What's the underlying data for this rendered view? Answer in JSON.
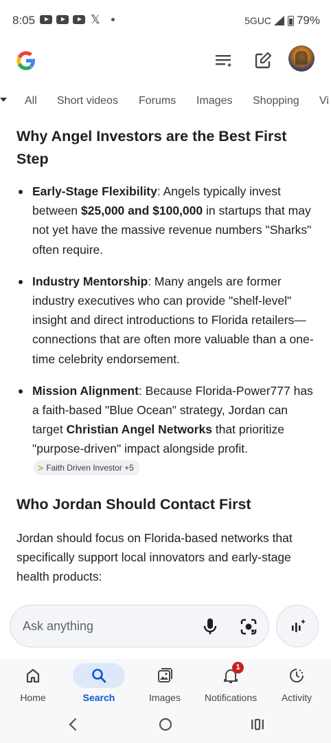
{
  "status_bar": {
    "time": "8:05",
    "network": "5GUC",
    "battery": "79%",
    "icons": [
      "youtube-icon",
      "youtube-icon",
      "youtube-icon",
      "x-icon",
      "dot-icon",
      "signal-icon",
      "battery-icon"
    ]
  },
  "app_bar": {
    "logo": "google-g-logo",
    "icons": [
      "filter-list-icon",
      "edit-note-icon",
      "profile-avatar"
    ]
  },
  "tabs": [
    "All",
    "Short videos",
    "Forums",
    "Images",
    "Shopping",
    "Vi"
  ],
  "content": {
    "heading1": "Why Angel Investors are the Best First Step",
    "bullets": [
      {
        "bold": "Early-Stage Flexibility",
        "t1": ": Angels typically invest between ",
        "bold2": "$25,000 and $100,000",
        "t2": " in startups that may not yet have the massive revenue numbers \"Sharks\" often require."
      },
      {
        "bold": "Industry Mentorship",
        "t1": ": Many angels are former industry executives who can provide \"shelf-level\" insight and direct introductions to Florida retailers—connections that are often more valuable than a one-time celebrity endorsement."
      },
      {
        "bold": "Mission Alignment",
        "t1": ": Because Florida-Power777 has a faith-based \"Blue Ocean\" strategy, Jordan can target ",
        "bold2": "Christian Angel Networks",
        "t2": " that prioritize \"purpose-driven\" impact alongside profit.",
        "chip": "Faith Driven Investor +5"
      }
    ],
    "heading2": "Who Jordan Should Contact First",
    "paragraph": "Jordan should focus on Florida-based networks that specifically support local innovators and early-stage health products:"
  },
  "ask": {
    "placeholder": "Ask anything"
  },
  "bottom_nav": [
    {
      "label": "Home",
      "icon": "home-icon"
    },
    {
      "label": "Search",
      "icon": "search-icon",
      "active": true
    },
    {
      "label": "Images",
      "icon": "images-icon"
    },
    {
      "label": "Notifications",
      "icon": "bell-icon",
      "badge": "1"
    },
    {
      "label": "Activity",
      "icon": "activity-icon"
    }
  ],
  "colors": {
    "accent": "#0b57d0",
    "active_pill": "#dde8fb",
    "badge": "#c5221f"
  }
}
